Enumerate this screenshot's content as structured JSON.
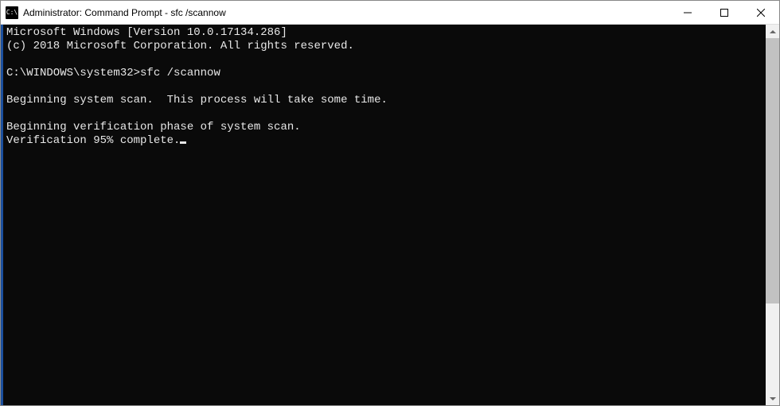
{
  "window": {
    "title": "Administrator: Command Prompt - sfc  /scannow",
    "icon_label": "C:\\"
  },
  "terminal": {
    "line1": "Microsoft Windows [Version 10.0.17134.286]",
    "line2": "(c) 2018 Microsoft Corporation. All rights reserved.",
    "blank1": "",
    "prompt": "C:\\WINDOWS\\system32>",
    "command": "sfc /scannow",
    "blank2": "",
    "line3": "Beginning system scan.  This process will take some time.",
    "blank3": "",
    "line4": "Beginning verification phase of system scan.",
    "line5": "Verification 95% complete."
  }
}
